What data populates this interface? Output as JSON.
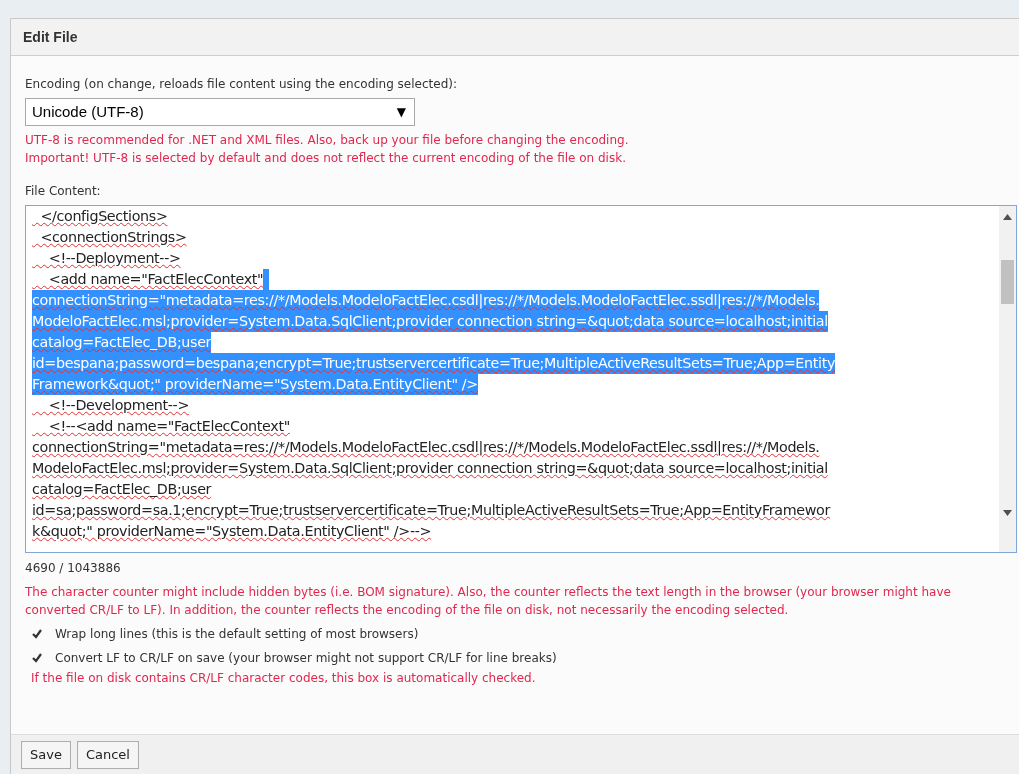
{
  "dialog": {
    "title": "Edit File"
  },
  "encoding": {
    "label": "Encoding (on change, reloads file content using the encoding selected):",
    "value": "Unicode (UTF-8)",
    "arrow": "▼",
    "notes": [
      "UTF-8 is recommended for .NET and XML files. Also, back up your file before changing the encoding.",
      "Important! UTF-8 is selected by default and does not reflect the current encoding of the file on disk."
    ]
  },
  "file_content": {
    "label": "File Content:",
    "lines": [
      [
        {
          "text": "  </configSections>",
          "selected": false
        }
      ],
      [
        {
          "text": "  <connectionStrings>",
          "selected": false
        }
      ],
      [
        {
          "text": "    <!--Deployment-->",
          "selected": false
        }
      ],
      [
        {
          "text": "    <add name=\"FactElecContext\"",
          "selected": false,
          "trailing_selection": true
        }
      ],
      [
        {
          "text": "connectionString=\"metadata=res://*/Models.ModeloFactElec.csdl|res://*/Models.ModeloFactElec.ssdl|res://*/Models.",
          "selected": true
        }
      ],
      [
        {
          "text": "ModeloFactElec.msl;provider=System.Data.SqlClient;provider connection string=&quot;data source=localhost;initial",
          "selected": true
        }
      ],
      [
        {
          "text": "catalog=FactElec_DB;user",
          "selected": true
        }
      ],
      [
        {
          "text": "id=bespana;password=bespana;encrypt=True;trustservercertificate=True;MultipleActiveResultSets=True;App=Entity",
          "selected": true
        }
      ],
      [
        {
          "text": "Framework&quot;\" providerName=\"System.Data.EntityClient\" />",
          "selected": true
        }
      ],
      [
        {
          "text": "    <!--Development-->",
          "selected": false
        }
      ],
      [
        {
          "text": "    <!--<add name=\"FactElecContext\"",
          "selected": false
        }
      ],
      [
        {
          "text": "connectionString=\"metadata=res://*/Models.ModeloFactElec.csdl|res://*/Models.ModeloFactElec.ssdl|res://*/Models.",
          "selected": false
        }
      ],
      [
        {
          "text": "ModeloFactElec.msl;provider=System.Data.SqlClient;provider connection string=&quot;data source=localhost;initial",
          "selected": false
        }
      ],
      [
        {
          "text": "catalog=FactElec_DB;user",
          "selected": false
        }
      ],
      [
        {
          "text": "id=sa;password=sa.1;encrypt=True;trustservercertificate=True;MultipleActiveResultSets=True;App=EntityFramewor",
          "selected": false
        }
      ],
      [
        {
          "text": "k&quot;\" providerName=\"System.Data.EntityClient\" />-->",
          "selected": false
        }
      ]
    ],
    "counter": "4690 / 1043886",
    "note": "The character counter might include hidden bytes (i.e. BOM signature). Also, the counter reflects the text length in the browser (your browser might have converted CR/LF to LF). In addition, the counter reflects the encoding of the file on disk, not necessarily the encoding selected."
  },
  "options": [
    {
      "label": "Wrap long lines (this is the default setting of most browsers)",
      "checked": true
    },
    {
      "label": "Convert LF to CR/LF on save (your browser might not support CR/LF for line breaks)",
      "checked": true
    }
  ],
  "options_note": "If the file on disk contains CR/LF character codes, this box is automatically checked.",
  "buttons": [
    "Save",
    "Cancel"
  ]
}
